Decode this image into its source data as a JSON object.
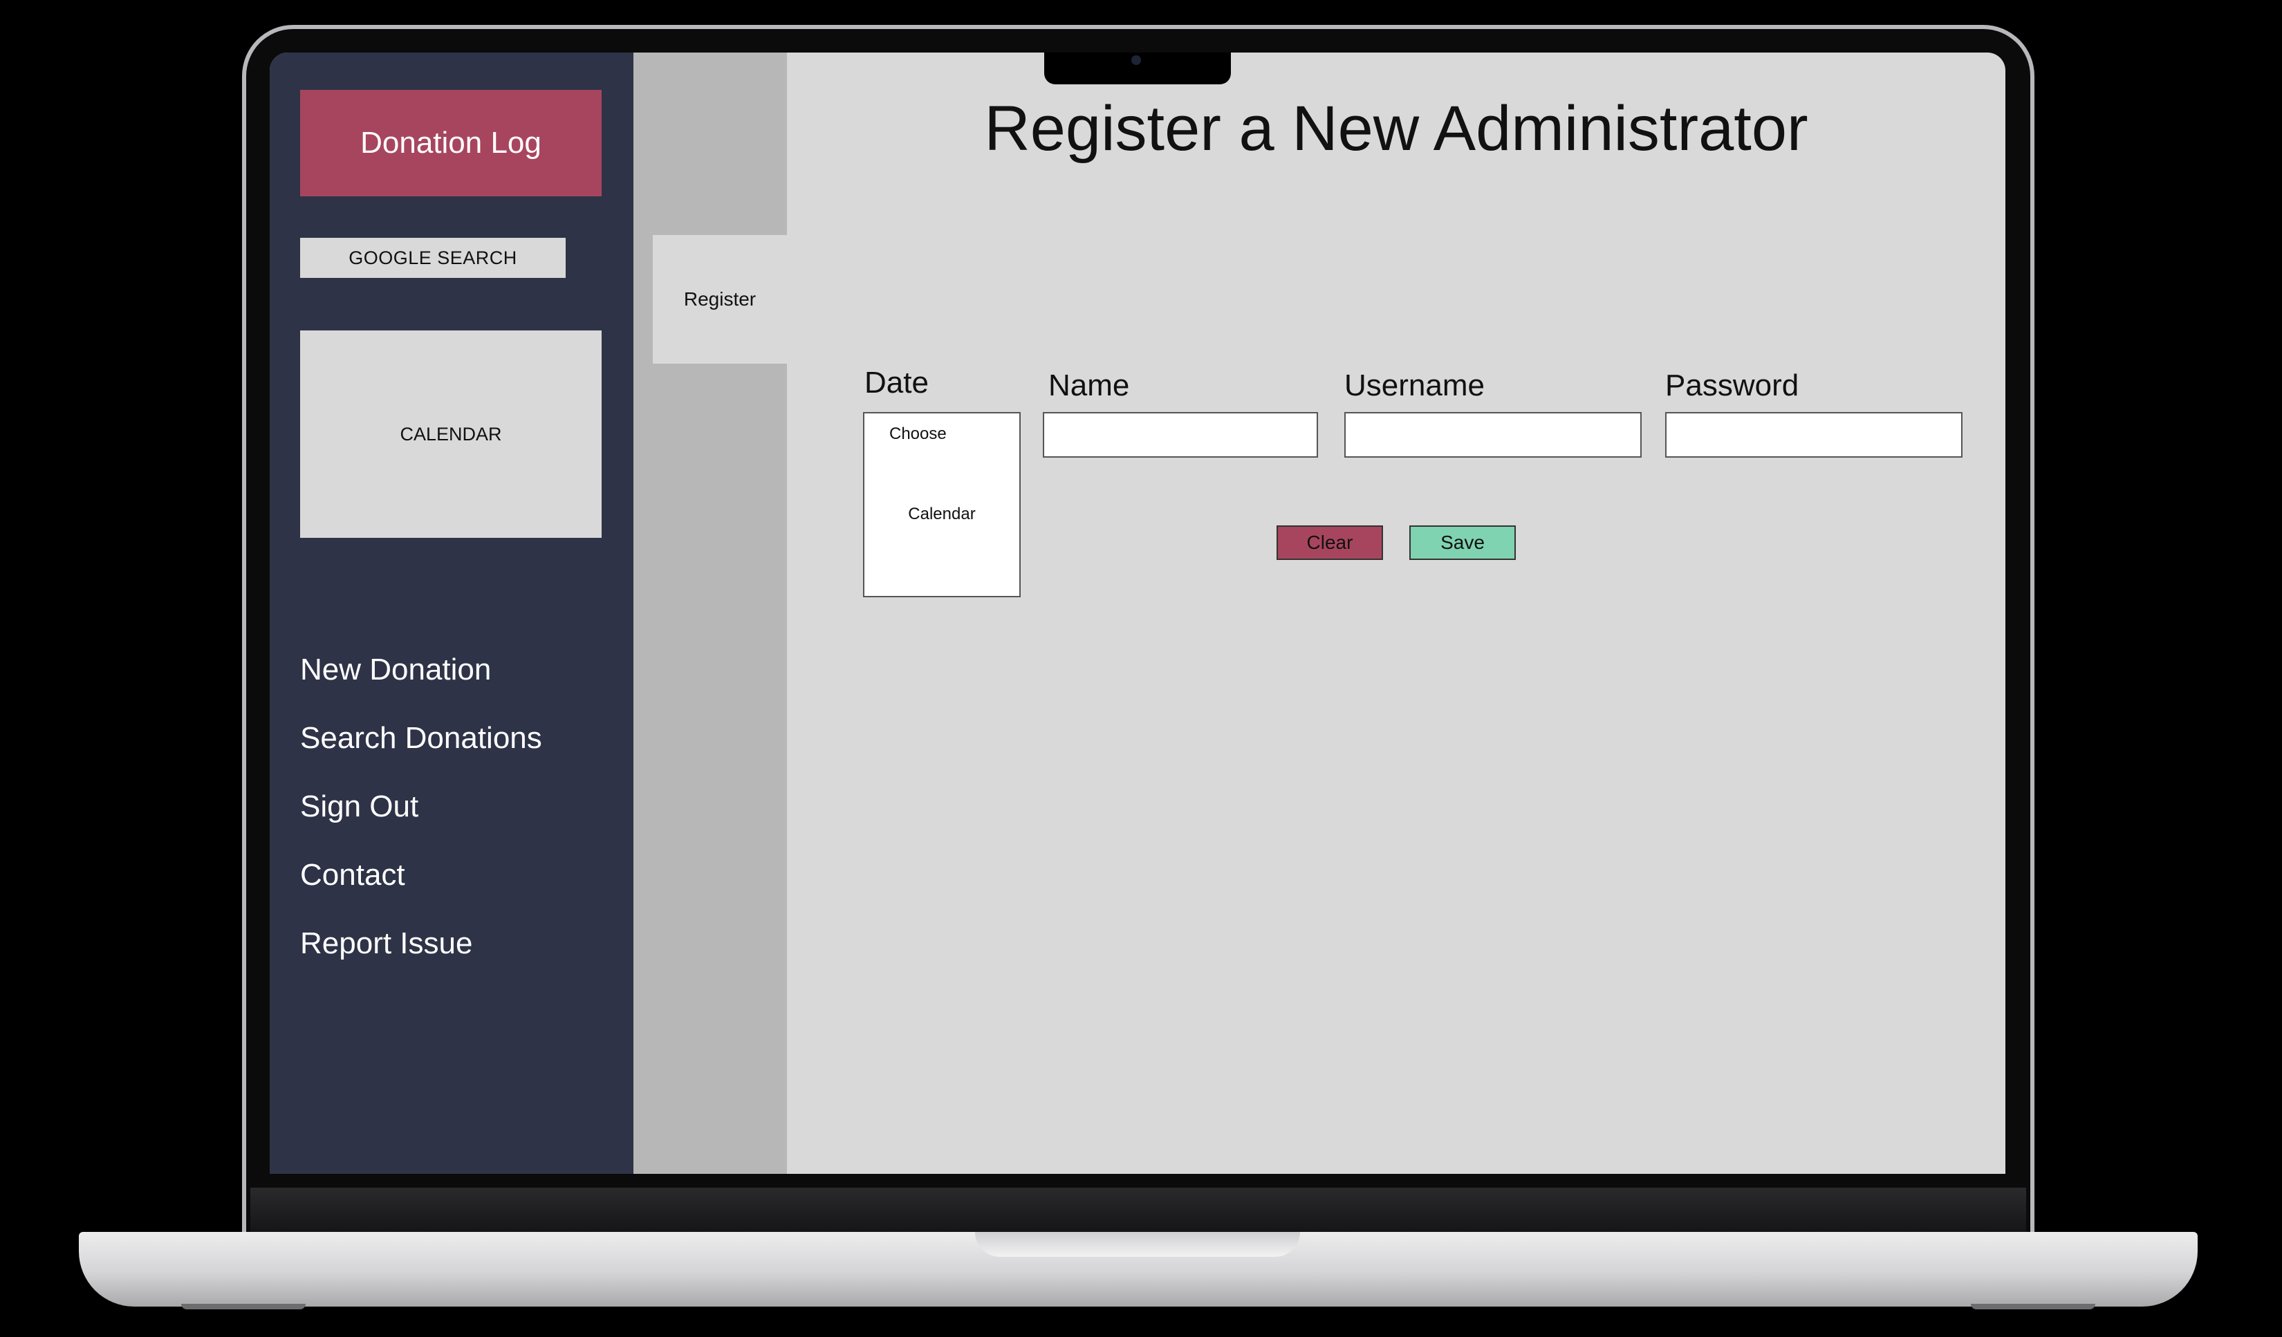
{
  "sidebar": {
    "brand": "Donation Log",
    "google_search": "GOOGLE SEARCH",
    "calendar": "CALENDAR",
    "nav": [
      {
        "label": "New Donation"
      },
      {
        "label": "Search Donations"
      },
      {
        "label": "Sign Out"
      },
      {
        "label": "Contact"
      },
      {
        "label": "Report Issue"
      }
    ]
  },
  "tabs": {
    "register": "Register"
  },
  "main": {
    "title": "Register a New Administrator",
    "form": {
      "date": {
        "label": "Date",
        "choose": "Choose",
        "calendar": "Calendar"
      },
      "name": {
        "label": "Name",
        "value": ""
      },
      "username": {
        "label": "Username",
        "value": ""
      },
      "password": {
        "label": "Password",
        "value": ""
      }
    },
    "buttons": {
      "clear": "Clear",
      "save": "Save"
    }
  },
  "colors": {
    "sidebar_bg": "#2e3347",
    "brand_accent": "#a8455e",
    "save_green": "#7fd3b0",
    "content_bg": "#d9d9d9",
    "secondary_column": "#b7b7b7"
  }
}
